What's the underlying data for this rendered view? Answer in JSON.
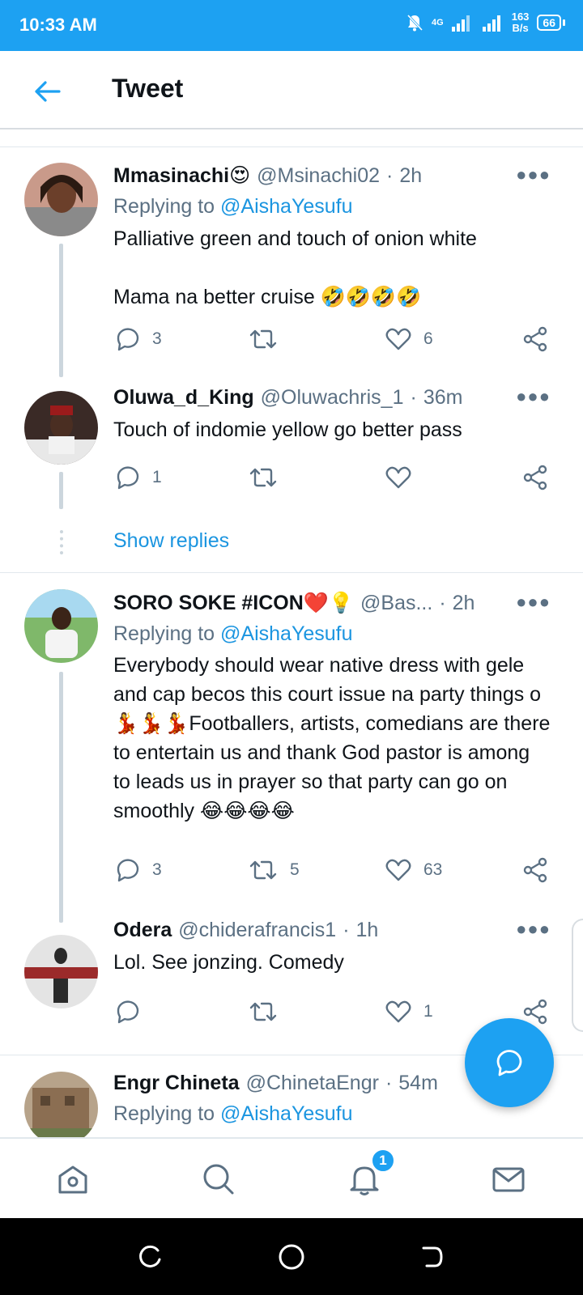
{
  "status_bar": {
    "time": "10:33 AM",
    "network": "4G",
    "speed_value": "163",
    "speed_unit": "B/s",
    "battery": "66"
  },
  "header": {
    "title": "Tweet"
  },
  "tweets": [
    {
      "name": "Mmasinachi😍",
      "handle": "@Msinachi02",
      "time": "2h",
      "replying_label": "Replying to",
      "replying_to": "@AishaYesufu",
      "text": "Palliative green and touch of onion white\n\nMama na better cruise 🤣🤣🤣🤣",
      "replies": "3",
      "retweets": "",
      "likes": "6"
    },
    {
      "name": "Oluwa_d_King",
      "handle": "@Oluwachris_1",
      "time": "36m",
      "text": "Touch of indomie yellow go better pass",
      "replies": "1",
      "retweets": "",
      "likes": ""
    },
    {
      "name": "SORO SOKE #ICON❤️💡",
      "handle": "@Bas...",
      "time": "2h",
      "replying_label": "Replying to",
      "replying_to": "@AishaYesufu",
      "text": "Everybody should wear native dress with gele and cap becos this court issue na party things o 💃💃💃Footballers, artists, comedians are there to entertain us and thank God pastor is among to leads us in prayer so that party can go on smoothly 😂😂😂😂",
      "replies": "3",
      "retweets": "5",
      "likes": "63"
    },
    {
      "name": "Odera",
      "handle": "@chiderafrancis1",
      "time": "1h",
      "text": "Lol. See jonzing. Comedy",
      "replies": "",
      "retweets": "",
      "likes": "1"
    },
    {
      "name": "Engr Chineta",
      "handle": "@ChinetaEngr",
      "time": "54m",
      "replying_label": "Replying to",
      "replying_to": "@AishaYesufu"
    }
  ],
  "show_replies": "Show replies",
  "nav": {
    "notifications_badge": "1",
    "icons": [
      "home-icon",
      "search-icon",
      "bell-icon",
      "mail-icon"
    ]
  },
  "colors": {
    "accent": "#1da1f2",
    "link": "#1b95e0",
    "muted": "#5b7083"
  }
}
